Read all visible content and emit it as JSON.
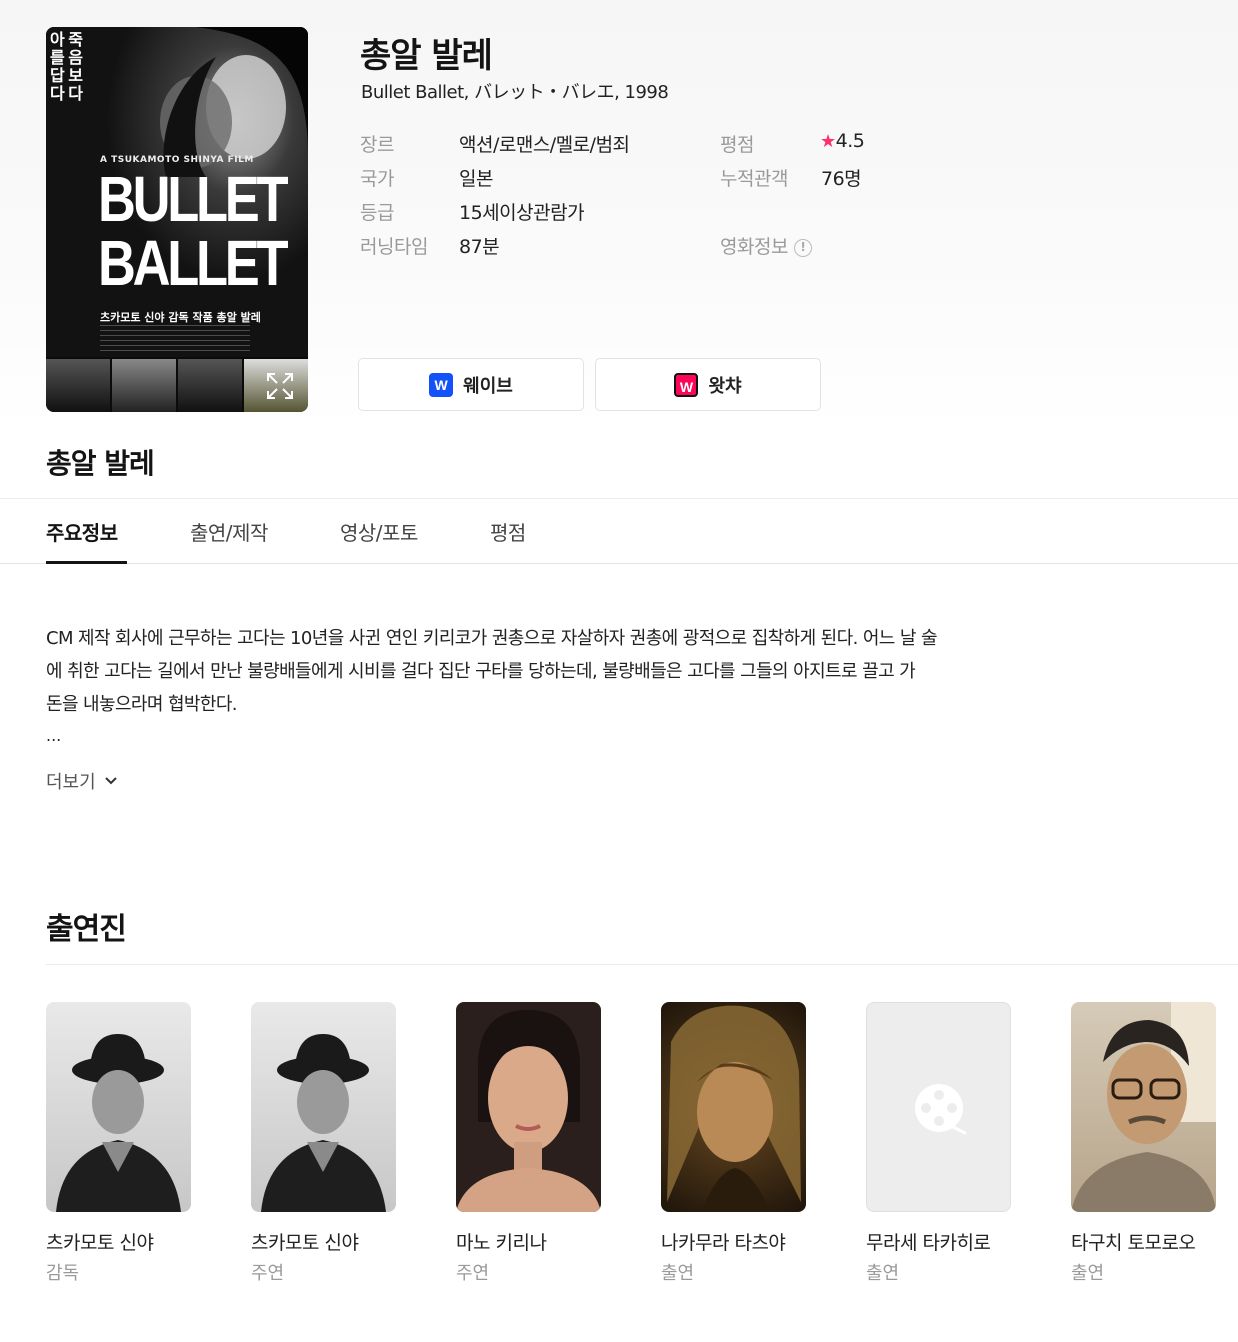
{
  "movie": {
    "title": "총알 발레",
    "subtitle": "Bullet Ballet, バレット・バレエ, 1998",
    "poster": {
      "tagline": "아 죽 를 음 답 보 다 다",
      "film_credit": "A TSUKAMOTO SHINYA FILM",
      "big_title": "BULLET BALLET",
      "sub_title": "츠카모토 신야 감독 작품 총알 발레"
    },
    "meta": {
      "genre_label": "장르",
      "genre_value": "액션/로맨스/멜로/범죄",
      "country_label": "국가",
      "country_value": "일본",
      "rating_label": "등급",
      "rating_value": "15세이상관람가",
      "runtime_label": "러닝타임",
      "runtime_value": "87분",
      "score_label": "평점",
      "score_value": "4.5",
      "audience_label": "누적관객",
      "audience_value": "76명",
      "movie_info_label": "영화정보"
    },
    "ott": [
      {
        "label": "웨이브",
        "logo": "W",
        "color": "#1351f9"
      },
      {
        "label": "왓챠",
        "logo": "W",
        "color": "#ff0558"
      }
    ]
  },
  "section_title": "총알 발레",
  "tabs": [
    "주요정보",
    "출연/제작",
    "영상/포토",
    "평점"
  ],
  "synopsis": {
    "line1": "CM 제작 회사에 근무하는 고다는 10년을 사귄 연인 키리코가 권총으로 자살하자 권총에 광적으로 집착하게 된다. 어느 날 술",
    "line2": "에 취한 고다는 길에서 만난 불량배들에게 시비를 걸다 집단 구타를 당하는데, 불량배들은 고다를 그들의 아지트로 끌고 가",
    "line3": "돈을 내놓으라며 협박한다.",
    "ellipsis": "...",
    "more_label": "더보기"
  },
  "cast_title": "출연진",
  "cast": [
    {
      "name": "츠카모토 신야",
      "role": "감독"
    },
    {
      "name": "츠카모토 신야",
      "role": "주연"
    },
    {
      "name": "마노 키리나",
      "role": "주연"
    },
    {
      "name": "나카무라 타츠야",
      "role": "출연"
    },
    {
      "name": "무라세 타카히로",
      "role": "출연"
    },
    {
      "name": "타구치 토모로오",
      "role": "출연"
    }
  ],
  "colors": {
    "accent_star": "#ff2f6e",
    "text_muted": "#9a9a9a"
  },
  "icons": [
    "expand-icon",
    "star-icon",
    "info-icon",
    "chevron-down-icon",
    "film-reel-icon"
  ]
}
